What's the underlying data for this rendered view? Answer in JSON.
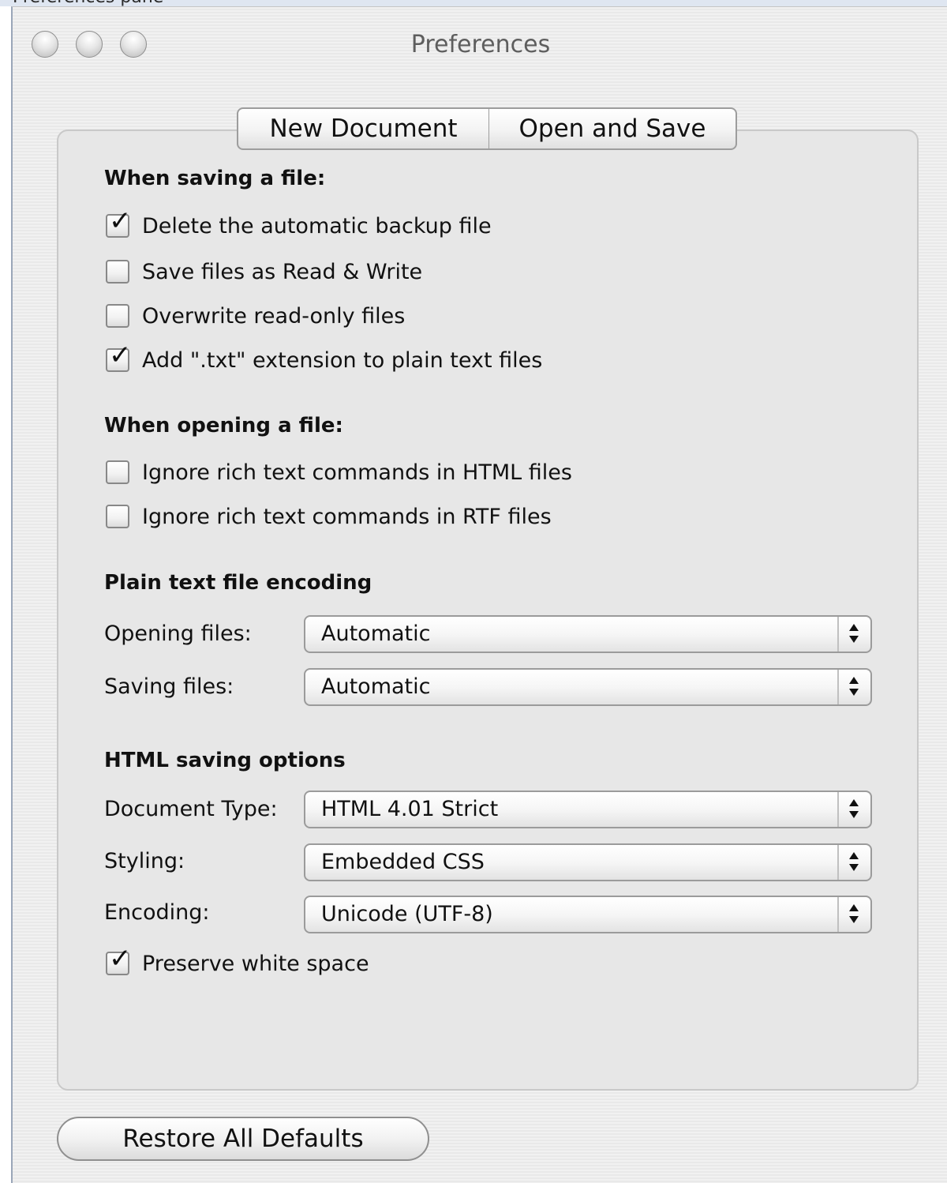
{
  "top_strip_text": "Preferences pane",
  "window": {
    "title": "Preferences"
  },
  "tabs": [
    {
      "label": "New Document",
      "selected": false
    },
    {
      "label": "Open and Save",
      "selected": true
    }
  ],
  "saving": {
    "heading": "When saving a file:",
    "options": [
      {
        "label": "Delete the automatic backup file",
        "checked": true
      },
      {
        "label": "Save files as Read & Write",
        "checked": false
      },
      {
        "label": "Overwrite read-only files",
        "checked": false
      },
      {
        "label": "Add \".txt\" extension to plain text files",
        "checked": true
      }
    ]
  },
  "opening": {
    "heading": "When opening a file:",
    "options": [
      {
        "label": "Ignore rich text commands in HTML files",
        "checked": false
      },
      {
        "label": "Ignore rich text commands in RTF files",
        "checked": false
      }
    ]
  },
  "encoding": {
    "heading": "Plain text file encoding",
    "opening_label": "Opening files:",
    "opening_value": "Automatic",
    "saving_label": "Saving files:",
    "saving_value": "Automatic"
  },
  "html_options": {
    "heading": "HTML saving options",
    "doc_type_label": "Document Type:",
    "doc_type_value": "HTML 4.01 Strict",
    "styling_label": "Styling:",
    "styling_value": "Embedded CSS",
    "encoding_label": "Encoding:",
    "encoding_value": "Unicode (UTF-8)",
    "preserve_label": "Preserve white space",
    "preserve_checked": true
  },
  "restore_button_label": "Restore All Defaults",
  "checkmark_glyph": "✓"
}
